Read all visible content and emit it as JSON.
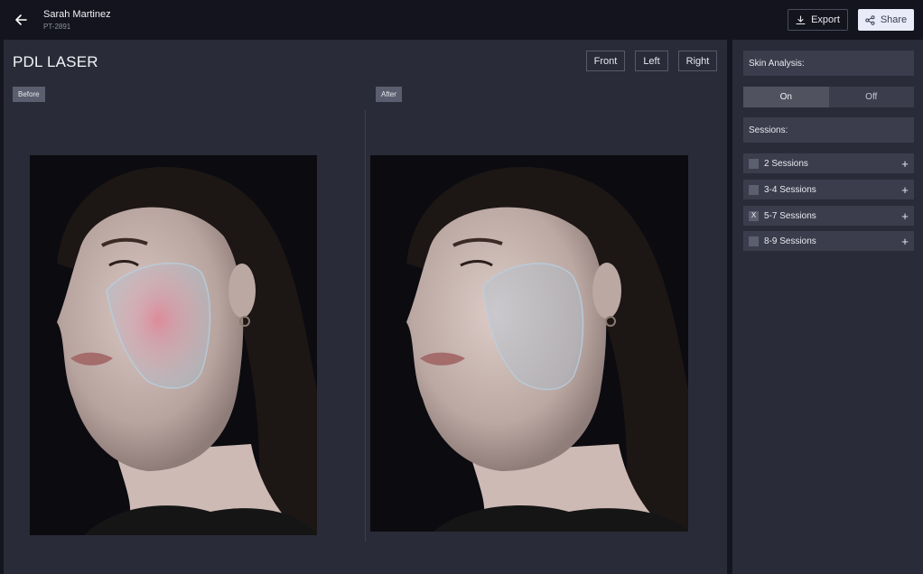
{
  "header": {
    "patient_name": "Sarah Martinez",
    "patient_id": "PT-2891",
    "export_label": "Export",
    "share_label": "Share"
  },
  "main": {
    "title": "PDL LASER",
    "views": [
      "Front",
      "Left",
      "Right"
    ],
    "before_label": "Before",
    "after_label": "After"
  },
  "sidebar": {
    "skin_analysis_label": "Skin Analysis:",
    "toggle": {
      "on": "On",
      "off": "Off",
      "selected": "On"
    },
    "sessions_label": "Sessions:",
    "sessions": [
      {
        "label": "2 Sessions",
        "checked": false,
        "mark": ""
      },
      {
        "label": "3-4 Sessions",
        "checked": false,
        "mark": ""
      },
      {
        "label": "5-7 Sessions",
        "checked": true,
        "mark": "X"
      },
      {
        "label": "8-9 Sessions",
        "checked": false,
        "mark": ""
      }
    ]
  },
  "icons": {
    "back": "arrow-left-icon",
    "export": "download-icon",
    "share": "share-icon",
    "add": "plus-icon"
  },
  "colors": {
    "background": "#14151f",
    "panel": "#292b38",
    "share_button": "#e9ecf8",
    "overlay_before": "#e07b8f",
    "overlay_after": "#a8c4d8"
  }
}
